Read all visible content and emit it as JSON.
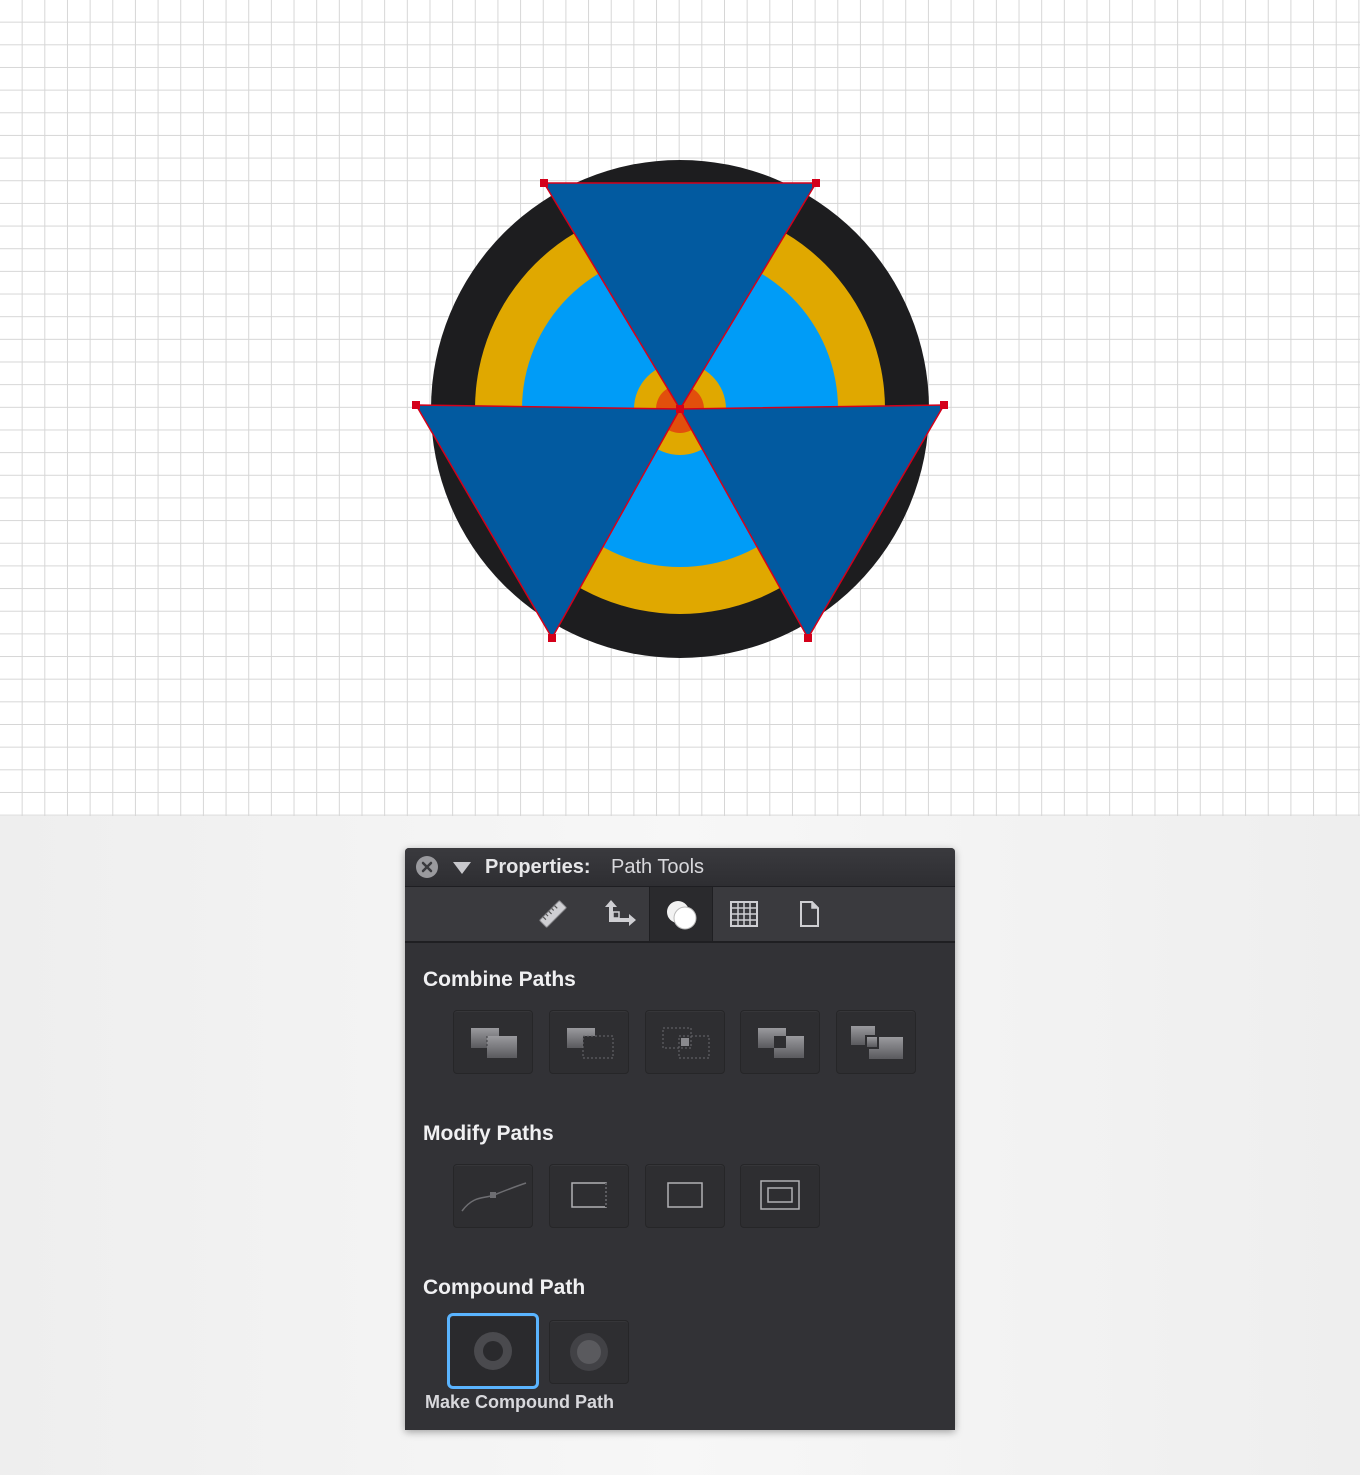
{
  "canvas": {
    "grid_color": "#d6d6d6",
    "background": "#ffffff",
    "artwork": {
      "ring_colors": {
        "outer": "#1d1d1f",
        "gold": "#e0a800",
        "blue": "#009cf7",
        "center_gold": "#e0a800",
        "center_orange": "#e24f0c",
        "blades": "#025aa0",
        "selection": "#d4001a"
      }
    }
  },
  "panel": {
    "title_strong": "Properties:",
    "title_sub": "Path Tools",
    "tabs": [
      {
        "name": "ruler-icon"
      },
      {
        "name": "transform-icon"
      },
      {
        "name": "path-tools-icon"
      },
      {
        "name": "grid-icon"
      },
      {
        "name": "document-icon"
      }
    ],
    "active_tab": "Path Tools",
    "sections": {
      "combine": {
        "title": "Combine Paths"
      },
      "modify": {
        "title": "Modify Paths"
      },
      "compound": {
        "title": "Compound Path"
      }
    },
    "tooltip": "Make Compound Path",
    "accent": "#5ab4ff"
  }
}
